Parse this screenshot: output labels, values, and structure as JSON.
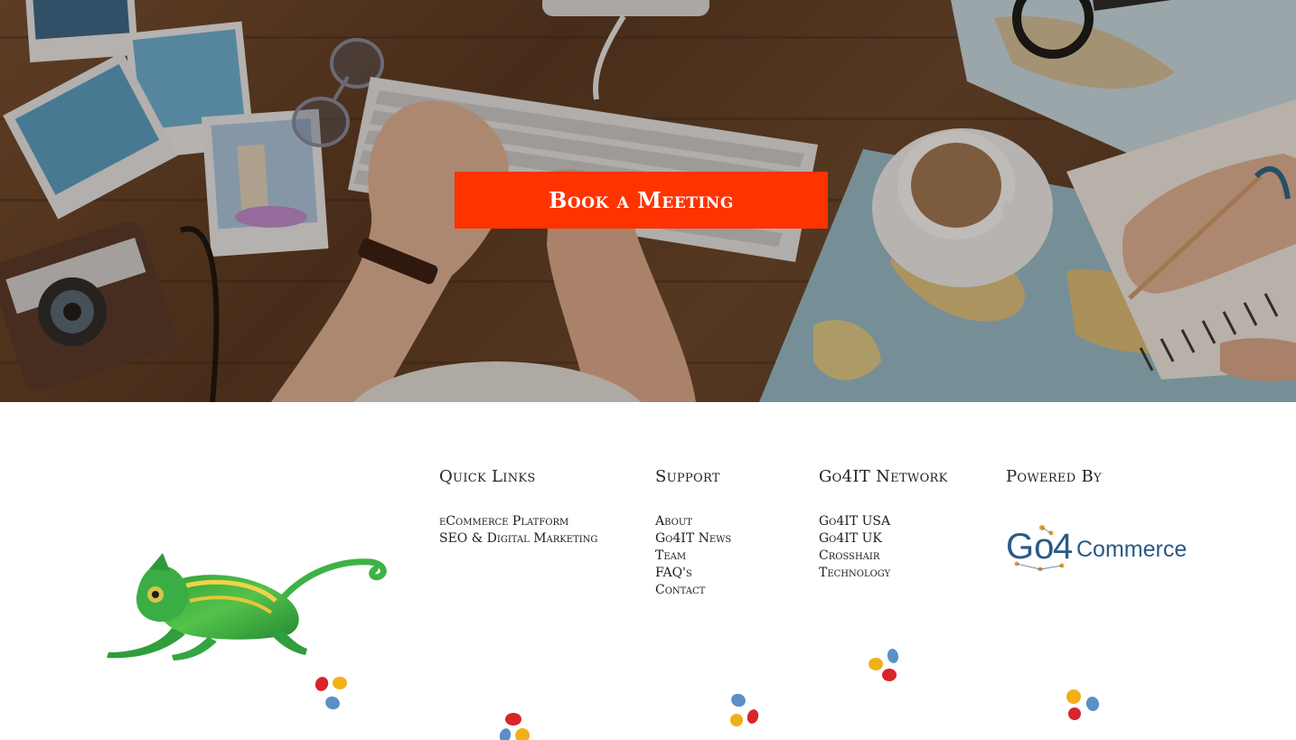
{
  "hero": {
    "cta_label": "Book a Meeting",
    "cta_color": "#ff3300"
  },
  "footer": {
    "quick_links": {
      "title": "Quick Links",
      "items": [
        "eCommerce Platform",
        "SEO & Digital Marketing"
      ]
    },
    "support": {
      "title": "Support",
      "items": [
        "About",
        "Go4IT News",
        "Team",
        "FAQ's",
        "Contact"
      ]
    },
    "network": {
      "title": "Go4IT Network",
      "items": [
        "Go4IT USA",
        "Go4IT UK",
        "Crosshair",
        "Technology"
      ]
    },
    "powered": {
      "title": "Powered By",
      "logo_text_prefix": "Go",
      "logo_text_number": "4",
      "logo_text_suffix": "Commerce"
    }
  },
  "colors": {
    "accent": "#ff3300",
    "blob_red": "#d8242b",
    "blob_yellow": "#f2b018",
    "blob_blue": "#5a8fc8",
    "logo_blue": "#2a5a86",
    "logo_orange": "#f09a2a"
  },
  "icons": [
    "chameleon-image",
    "colored-dots-icon",
    "go4commerce-logo"
  ]
}
